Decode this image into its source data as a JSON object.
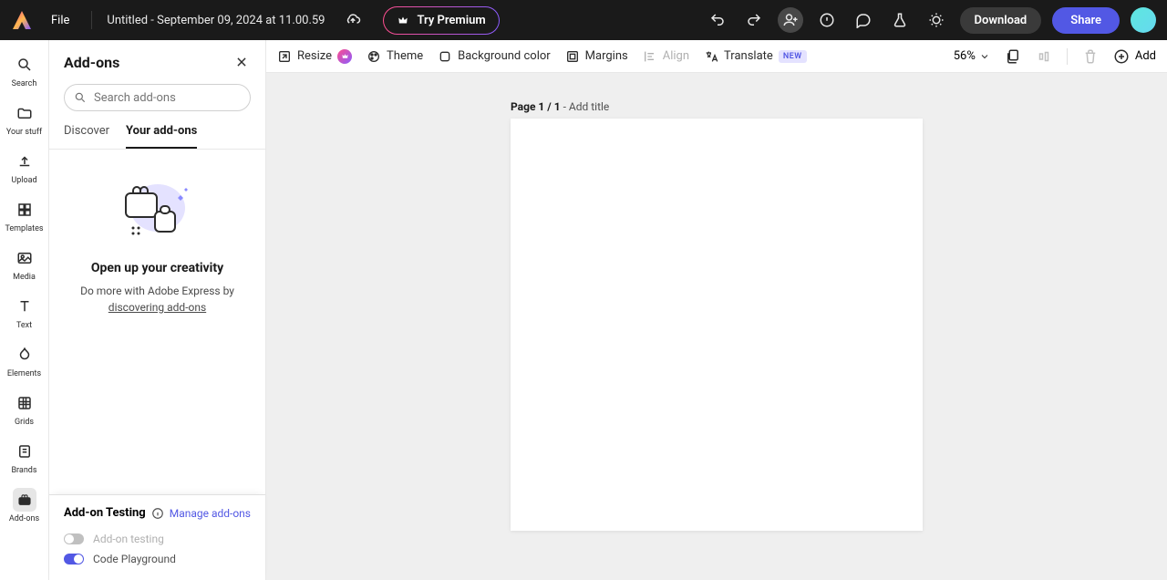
{
  "header": {
    "file_menu": "File",
    "doc_title": "Untitled - September 09, 2024 at 11.00.59",
    "try_premium": "Try Premium",
    "download": "Download",
    "share": "Share"
  },
  "rail": {
    "items": [
      {
        "label": "Search"
      },
      {
        "label": "Your stuff"
      },
      {
        "label": "Upload"
      },
      {
        "label": "Templates"
      },
      {
        "label": "Media"
      },
      {
        "label": "Text"
      },
      {
        "label": "Elements"
      },
      {
        "label": "Grids"
      },
      {
        "label": "Brands"
      },
      {
        "label": "Add-ons"
      }
    ]
  },
  "sidebar": {
    "title": "Add-ons",
    "search_placeholder": "Search add-ons",
    "tabs": {
      "discover": "Discover",
      "yours": "Your add-ons"
    },
    "empty": {
      "title": "Open up your creativity",
      "desc_prefix": "Do more with Adobe Express by ",
      "desc_link": "discovering add-ons"
    },
    "testing": {
      "title": "Add-on Testing",
      "manage": "Manage add-ons",
      "toggle1": "Add-on testing",
      "toggle2": "Code Playground"
    }
  },
  "toolbar": {
    "resize": "Resize",
    "theme": "Theme",
    "bgcolor": "Background color",
    "margins": "Margins",
    "align": "Align",
    "translate": "Translate",
    "new_badge": "NEW",
    "zoom": "56%",
    "add": "Add"
  },
  "canvas": {
    "page_prefix": "Page 1 / 1",
    "page_suffix": " - Add title"
  }
}
